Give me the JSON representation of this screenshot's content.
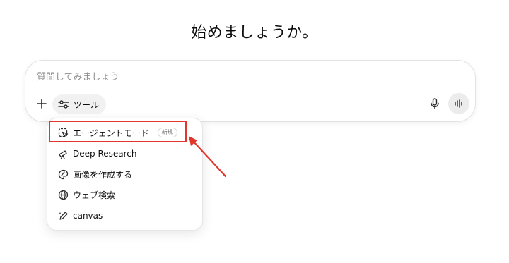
{
  "heading": "始めましょうか。",
  "composer": {
    "placeholder": "質問してみましょう",
    "tools_label": "ツール",
    "plus_icon": "plus-icon",
    "tools_icon": "sliders-icon",
    "mic_icon": "microphone-icon",
    "voice_icon": "voice-waveform-icon"
  },
  "tools_menu": {
    "items": [
      {
        "label": "エージェントモード",
        "badge": "新規",
        "icon": "agent-cursor-icon"
      },
      {
        "label": "Deep Research",
        "icon": "telescope-icon"
      },
      {
        "label": "画像を作成する",
        "icon": "image-palette-icon"
      },
      {
        "label": "ウェブ検索",
        "icon": "globe-icon"
      },
      {
        "label": "canvas",
        "icon": "pen-canvas-icon"
      }
    ]
  },
  "annotation": {
    "highlight_color": "#e0362b"
  }
}
